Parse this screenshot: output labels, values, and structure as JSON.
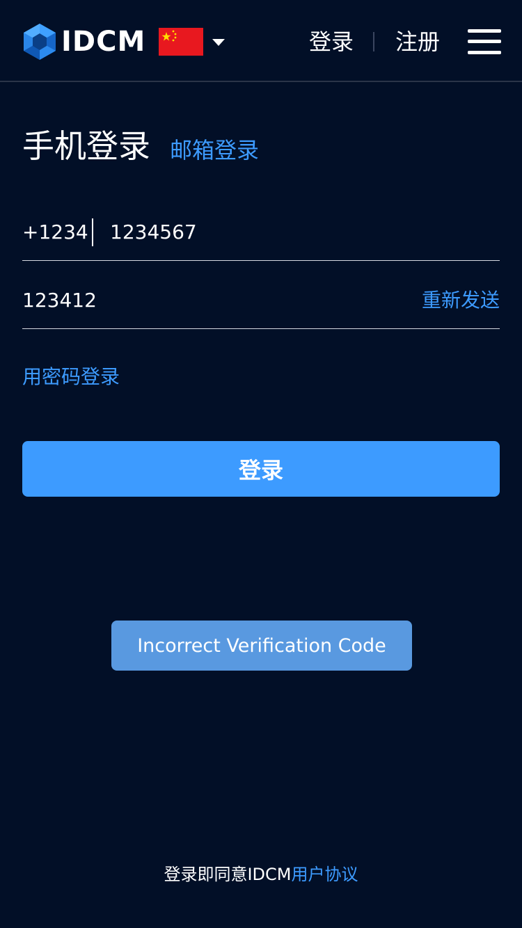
{
  "header": {
    "brand": "IDCM",
    "login_label": "登录",
    "register_label": "注册",
    "flag": "china-flag",
    "colors": {
      "background": "#020F27",
      "accent": "#3D9BFF",
      "flag_red": "#E8181F"
    }
  },
  "tabs": {
    "phone_login": "手机登录",
    "email_login": "邮箱登录"
  },
  "form": {
    "country_code": "+1234",
    "phone_value": "1234567",
    "code_value": "123412",
    "resend_label": "重新发送",
    "password_login_label": "用密码登录",
    "submit_label": "登录"
  },
  "toast": {
    "message": "Incorrect Verification Code"
  },
  "footer": {
    "prefix": "登录即同意IDCM",
    "agreement_link": "用户协议"
  }
}
